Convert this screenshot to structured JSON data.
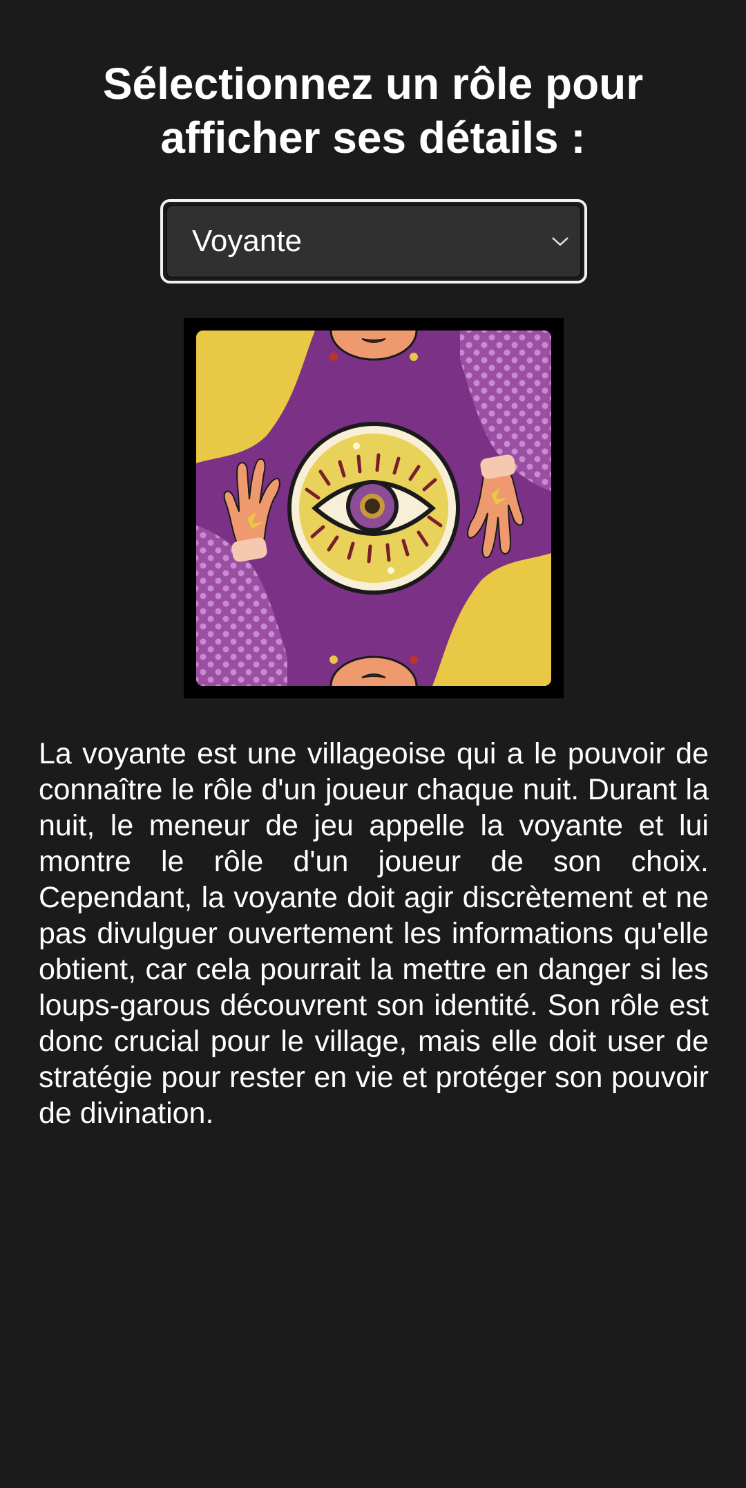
{
  "header": {
    "title_line1": "Sélectionnez un rôle pour",
    "title_line2": "afficher ses détails :"
  },
  "role_select": {
    "selected": "Voyante"
  },
  "role_card": {
    "icon": "eye-icon",
    "colors": {
      "purple": "#7b3185",
      "yellow": "#e9c845",
      "skin": "#ee9a6e",
      "frame": "#000000"
    }
  },
  "description": "La voyante est une villageoise qui a le pouvoir de connaître le rôle d'un joueur chaque nuit. Durant la nuit, le meneur de jeu appelle la voyante et lui montre le rôle d'un joueur de son choix. Cependant, la voyante doit agir discrètement et ne pas divulguer ouvertement les informations qu'elle obtient, car cela pourrait la mettre en danger si les loups-garous découvrent son identité. Son rôle est donc crucial pour le village, mais elle doit user de stratégie pour rester en vie et protéger son pouvoir de divination."
}
